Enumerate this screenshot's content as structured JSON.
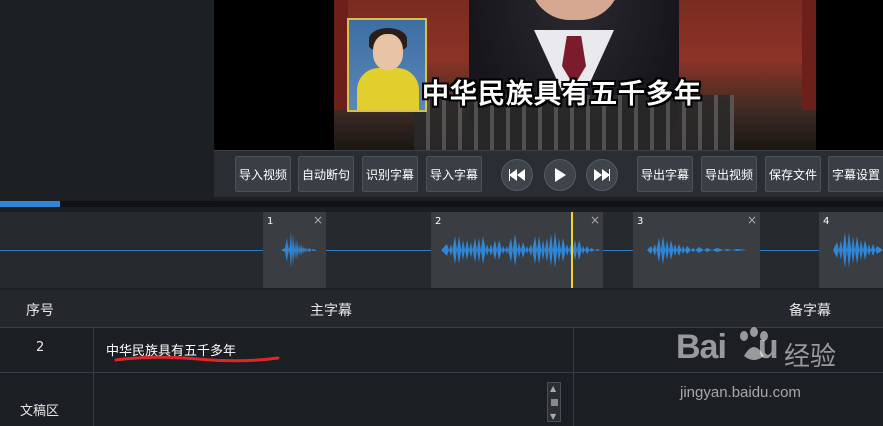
{
  "video": {
    "caption": "中华民族具有五千多年"
  },
  "toolbar": {
    "import_video": "导入视频",
    "auto_split": "自动断句",
    "recognize_subtitle": "识别字幕",
    "import_subtitle": "导入字幕",
    "export_subtitle": "导出字幕",
    "export_video": "导出视频",
    "save_file": "保存文件",
    "subtitle_settings": "字幕设置"
  },
  "progress": {
    "fraction": 0.068
  },
  "waveform": {
    "segments": [
      {
        "num": "1",
        "close": "×"
      },
      {
        "num": "2",
        "close": "×"
      },
      {
        "num": "3",
        "close": "×"
      },
      {
        "num": "4",
        "close": ""
      }
    ]
  },
  "table": {
    "headers": {
      "index": "序号",
      "main": "主字幕",
      "secondary": "备字幕"
    },
    "rows": [
      {
        "index": "2",
        "main": "中华民族具有五千多年",
        "secondary": ""
      }
    ],
    "draft_label": "文稿区"
  },
  "watermark": {
    "brand": "Bai",
    "brand_suffix": "u",
    "cn": "经验",
    "url": "jingyan.baidu.com"
  },
  "colors": {
    "accent": "#2f86d6",
    "playhead": "#f2d32c",
    "underline": "#e0262b"
  }
}
